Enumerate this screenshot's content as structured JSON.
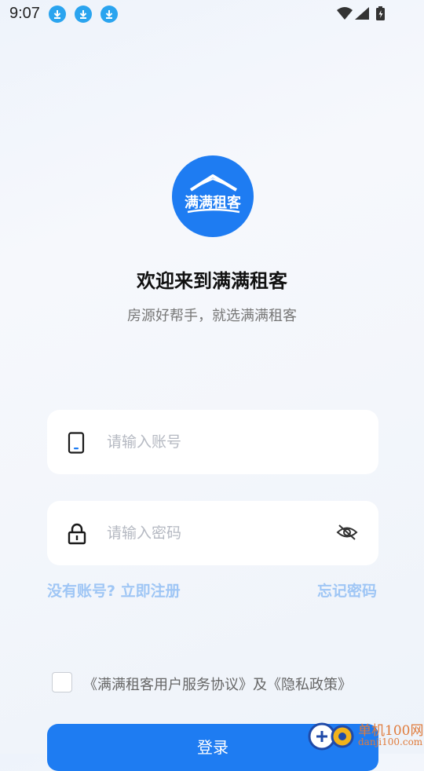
{
  "status_bar": {
    "time": "9:07"
  },
  "logo": {
    "text": "满满租客"
  },
  "header": {
    "title": "欢迎来到满满租客",
    "subtitle": "房源好帮手，就选满满租客"
  },
  "account": {
    "placeholder": "请输入账号",
    "icon": "phone-icon"
  },
  "password": {
    "placeholder": "请输入密码",
    "icon": "lock-icon",
    "toggle_icon": "eye-off-icon"
  },
  "links": {
    "register": "没有账号? 立即注册",
    "forgot": "忘记密码"
  },
  "agreement": {
    "text": "《满满租客用户服务协议》及《隐私政策》"
  },
  "login_button": {
    "label": "登录"
  },
  "watermark": {
    "line1": "单机100网",
    "line2": "danji100.com"
  },
  "colors": {
    "primary": "#1e7cf2",
    "link": "#9fc6f5"
  }
}
